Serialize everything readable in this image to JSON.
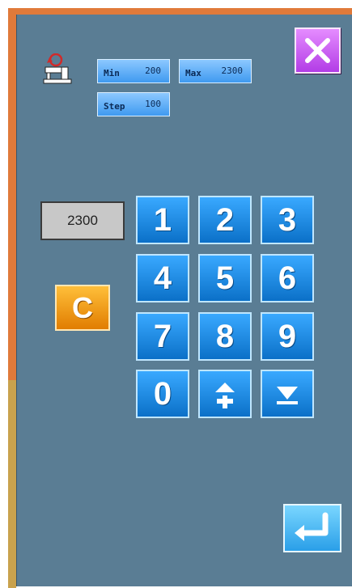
{
  "params": {
    "min": {
      "label": "Min",
      "value": "200"
    },
    "max": {
      "label": "Max",
      "value": "2300"
    },
    "step": {
      "label": "Step",
      "value": "100"
    }
  },
  "display_value": "2300",
  "keypad": {
    "clear": "C",
    "keys": [
      "1",
      "2",
      "3",
      "4",
      "5",
      "6",
      "7",
      "8",
      "9",
      "0"
    ]
  },
  "icons": {
    "machine": "sewing-machine-icon",
    "close": "close-icon",
    "increment": "plus-up-icon",
    "decrement": "down-arrow-icon",
    "enter": "enter-icon"
  },
  "colors": {
    "panel_bg": "#5a7d94",
    "key_blue": "#1f8cff",
    "clear_orange": "#f29a0e",
    "close_purple": "#d06bff",
    "frame_orange": "#e07a3a",
    "frame_gold": "#c9a24d"
  }
}
